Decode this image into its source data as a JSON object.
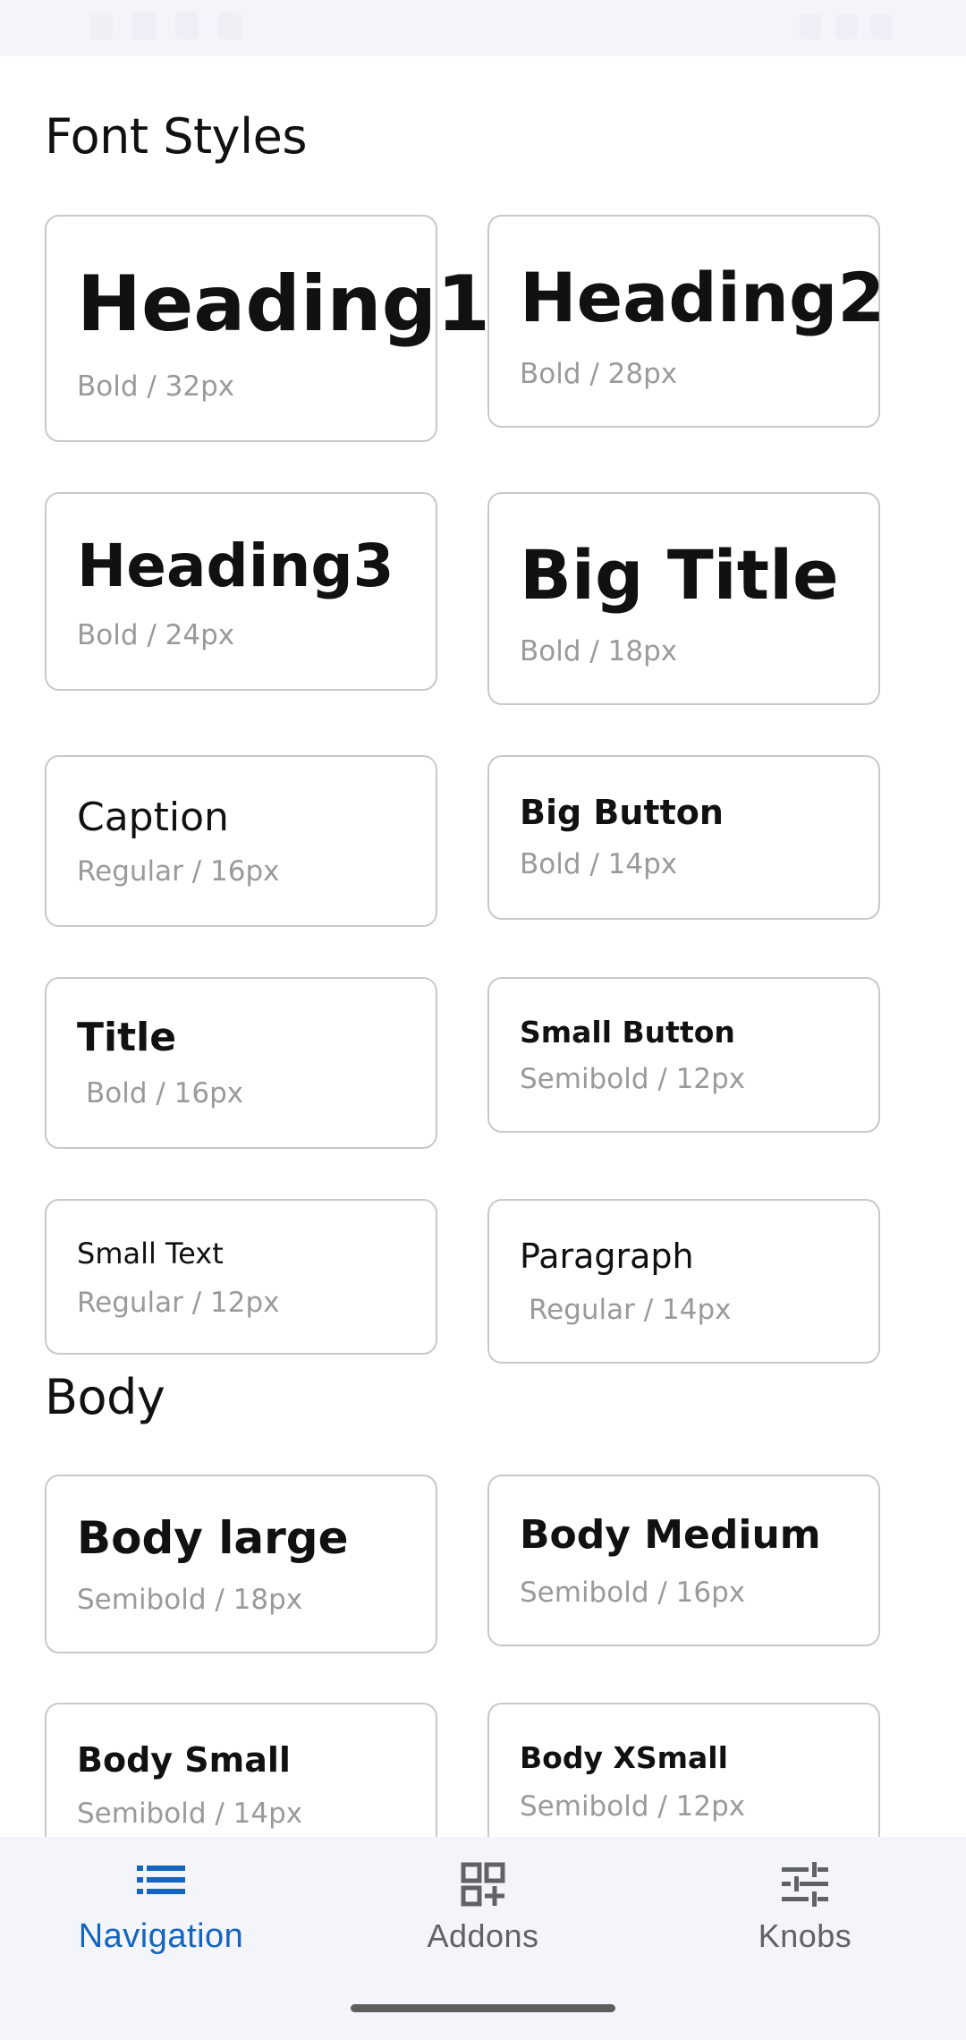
{
  "sections": {
    "font_styles": "Font Styles",
    "body": "Body"
  },
  "cards": {
    "heading1": {
      "name": "Heading1",
      "spec": "Bold / 32px"
    },
    "heading2": {
      "name": "Heading2",
      "spec": "Bold / 28px"
    },
    "heading3": {
      "name": "Heading3",
      "spec": "Bold / 24px"
    },
    "big_title": {
      "name": "Big Title",
      "spec": "Bold / 18px"
    },
    "caption": {
      "name": "Caption",
      "spec": "Regular / 16px"
    },
    "big_button": {
      "name": "Big Button",
      "spec": "Bold / 14px"
    },
    "title": {
      "name": "Title",
      "spec": "Bold / 16px"
    },
    "small_button": {
      "name": "Small Button",
      "spec": "Semibold / 12px"
    },
    "small_text": {
      "name": "Small Text",
      "spec": "Regular / 12px"
    },
    "paragraph": {
      "name": "Paragraph",
      "spec": "Regular / 14px"
    },
    "body_large": {
      "name": "Body large",
      "spec": "Semibold / 18px"
    },
    "body_medium": {
      "name": "Body Medium",
      "spec": "Semibold / 16px"
    },
    "body_small": {
      "name": "Body Small",
      "spec": "Semibold / 14px"
    },
    "body_xsmall": {
      "name": "Body XSmall",
      "spec": "Semibold / 12px"
    }
  },
  "bottom_nav": {
    "items": [
      {
        "label": "Navigation",
        "icon": "list-icon",
        "active": true
      },
      {
        "label": "Addons",
        "icon": "grid-add-icon",
        "active": false
      },
      {
        "label": "Knobs",
        "icon": "sliders-icon",
        "active": false
      }
    ],
    "active_color": "#1565c0",
    "inactive_color": "#5f6368"
  }
}
